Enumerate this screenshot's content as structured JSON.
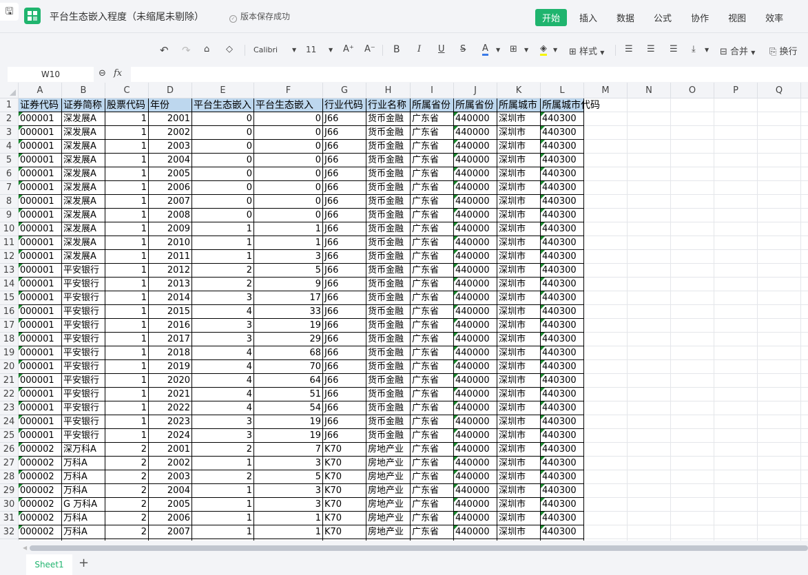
{
  "app": {
    "title": "平台生态嵌入程度（未缩尾未剔除）",
    "save_status": "版本保存成功",
    "brand_color": "#1fb46e"
  },
  "menu": [
    "开始",
    "插入",
    "数据",
    "公式",
    "协作",
    "视图",
    "效率"
  ],
  "toolbar": {
    "font": "Calibri",
    "size": "11",
    "style_label": "样式",
    "merge_label": "合并",
    "wrap_label": "换行",
    "font_color": "#3b7be8",
    "fill_color": "#f5f500"
  },
  "formula_bar": {
    "name_box": "W10",
    "fx": "fx",
    "value": ""
  },
  "columns": [
    "A",
    "B",
    "C",
    "D",
    "E",
    "F",
    "G",
    "H",
    "I",
    "J",
    "K",
    "L",
    "M",
    "N",
    "O",
    "P",
    "Q"
  ],
  "header_row": [
    "证券代码",
    "证券简称",
    "股票代码",
    "年份",
    "平台生态嵌入",
    "平台生态嵌入",
    "行业代码",
    "行业名称",
    "所属省份",
    "所属省份",
    "所属城市",
    "所属城市代码"
  ],
  "rows": [
    [
      "000001",
      "深发展A",
      "1",
      "2001",
      "0",
      "0",
      "J66",
      "货币金融",
      "广东省",
      "440000",
      "深圳市",
      "440300"
    ],
    [
      "000001",
      "深发展A",
      "1",
      "2002",
      "0",
      "0",
      "J66",
      "货币金融",
      "广东省",
      "440000",
      "深圳市",
      "440300"
    ],
    [
      "000001",
      "深发展A",
      "1",
      "2003",
      "0",
      "0",
      "J66",
      "货币金融",
      "广东省",
      "440000",
      "深圳市",
      "440300"
    ],
    [
      "000001",
      "深发展A",
      "1",
      "2004",
      "0",
      "0",
      "J66",
      "货币金融",
      "广东省",
      "440000",
      "深圳市",
      "440300"
    ],
    [
      "000001",
      "深发展A",
      "1",
      "2005",
      "0",
      "0",
      "J66",
      "货币金融",
      "广东省",
      "440000",
      "深圳市",
      "440300"
    ],
    [
      "000001",
      "深发展A",
      "1",
      "2006",
      "0",
      "0",
      "J66",
      "货币金融",
      "广东省",
      "440000",
      "深圳市",
      "440300"
    ],
    [
      "000001",
      "深发展A",
      "1",
      "2007",
      "0",
      "0",
      "J66",
      "货币金融",
      "广东省",
      "440000",
      "深圳市",
      "440300"
    ],
    [
      "000001",
      "深发展A",
      "1",
      "2008",
      "0",
      "0",
      "J66",
      "货币金融",
      "广东省",
      "440000",
      "深圳市",
      "440300"
    ],
    [
      "000001",
      "深发展A",
      "1",
      "2009",
      "1",
      "1",
      "J66",
      "货币金融",
      "广东省",
      "440000",
      "深圳市",
      "440300"
    ],
    [
      "000001",
      "深发展A",
      "1",
      "2010",
      "1",
      "1",
      "J66",
      "货币金融",
      "广东省",
      "440000",
      "深圳市",
      "440300"
    ],
    [
      "000001",
      "深发展A",
      "1",
      "2011",
      "1",
      "3",
      "J66",
      "货币金融",
      "广东省",
      "440000",
      "深圳市",
      "440300"
    ],
    [
      "000001",
      "平安银行",
      "1",
      "2012",
      "2",
      "5",
      "J66",
      "货币金融",
      "广东省",
      "440000",
      "深圳市",
      "440300"
    ],
    [
      "000001",
      "平安银行",
      "1",
      "2013",
      "2",
      "9",
      "J66",
      "货币金融",
      "广东省",
      "440000",
      "深圳市",
      "440300"
    ],
    [
      "000001",
      "平安银行",
      "1",
      "2014",
      "3",
      "17",
      "J66",
      "货币金融",
      "广东省",
      "440000",
      "深圳市",
      "440300"
    ],
    [
      "000001",
      "平安银行",
      "1",
      "2015",
      "4",
      "33",
      "J66",
      "货币金融",
      "广东省",
      "440000",
      "深圳市",
      "440300"
    ],
    [
      "000001",
      "平安银行",
      "1",
      "2016",
      "3",
      "19",
      "J66",
      "货币金融",
      "广东省",
      "440000",
      "深圳市",
      "440300"
    ],
    [
      "000001",
      "平安银行",
      "1",
      "2017",
      "3",
      "29",
      "J66",
      "货币金融",
      "广东省",
      "440000",
      "深圳市",
      "440300"
    ],
    [
      "000001",
      "平安银行",
      "1",
      "2018",
      "4",
      "68",
      "J66",
      "货币金融",
      "广东省",
      "440000",
      "深圳市",
      "440300"
    ],
    [
      "000001",
      "平安银行",
      "1",
      "2019",
      "4",
      "70",
      "J66",
      "货币金融",
      "广东省",
      "440000",
      "深圳市",
      "440300"
    ],
    [
      "000001",
      "平安银行",
      "1",
      "2020",
      "4",
      "64",
      "J66",
      "货币金融",
      "广东省",
      "440000",
      "深圳市",
      "440300"
    ],
    [
      "000001",
      "平安银行",
      "1",
      "2021",
      "4",
      "51",
      "J66",
      "货币金融",
      "广东省",
      "440000",
      "深圳市",
      "440300"
    ],
    [
      "000001",
      "平安银行",
      "1",
      "2022",
      "4",
      "54",
      "J66",
      "货币金融",
      "广东省",
      "440000",
      "深圳市",
      "440300"
    ],
    [
      "000001",
      "平安银行",
      "1",
      "2023",
      "3",
      "19",
      "J66",
      "货币金融",
      "广东省",
      "440000",
      "深圳市",
      "440300"
    ],
    [
      "000001",
      "平安银行",
      "1",
      "2024",
      "3",
      "19",
      "J66",
      "货币金融",
      "广东省",
      "440000",
      "深圳市",
      "440300"
    ],
    [
      "000002",
      "深万科A",
      "2",
      "2001",
      "2",
      "7",
      "K70",
      "房地产业",
      "广东省",
      "440000",
      "深圳市",
      "440300"
    ],
    [
      "000002",
      "万科A",
      "2",
      "2002",
      "1",
      "3",
      "K70",
      "房地产业",
      "广东省",
      "440000",
      "深圳市",
      "440300"
    ],
    [
      "000002",
      "万科A",
      "2",
      "2003",
      "2",
      "5",
      "K70",
      "房地产业",
      "广东省",
      "440000",
      "深圳市",
      "440300"
    ],
    [
      "000002",
      "万科A",
      "2",
      "2004",
      "1",
      "3",
      "K70",
      "房地产业",
      "广东省",
      "440000",
      "深圳市",
      "440300"
    ],
    [
      "000002",
      "G 万科A",
      "2",
      "2005",
      "1",
      "3",
      "K70",
      "房地产业",
      "广东省",
      "440000",
      "深圳市",
      "440300"
    ],
    [
      "000002",
      "万科A",
      "2",
      "2006",
      "1",
      "1",
      "K70",
      "房地产业",
      "广东省",
      "440000",
      "深圳市",
      "440300"
    ],
    [
      "000002",
      "万科A",
      "2",
      "2007",
      "1",
      "1",
      "K70",
      "房地产业",
      "广东省",
      "440000",
      "深圳市",
      "440300"
    ]
  ],
  "sheets": [
    "Sheet1"
  ],
  "add_sheet": "+"
}
